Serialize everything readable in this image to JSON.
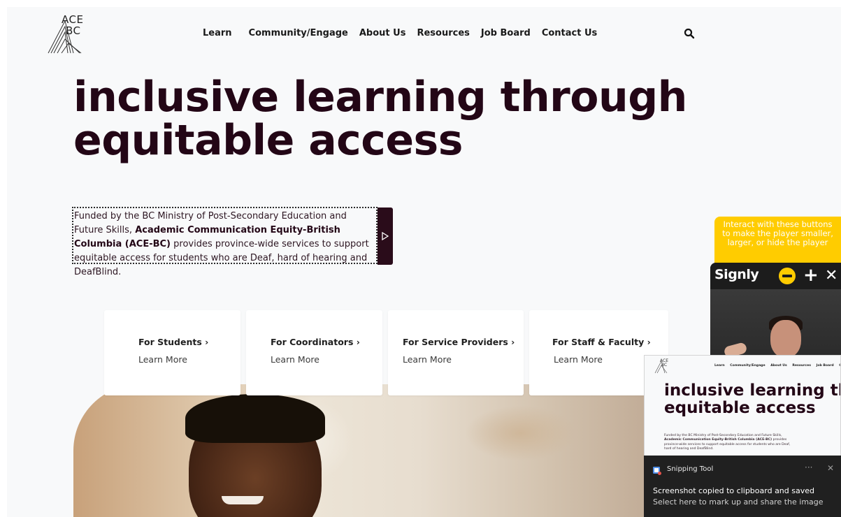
{
  "logo": {
    "line1": "ACE",
    "line2": "BC"
  },
  "nav": {
    "items": [
      "Learn",
      "Community/Engage",
      "About Us",
      "Resources",
      "Job Board",
      "Contact Us"
    ],
    "search_icon": "search-icon"
  },
  "hero": {
    "title_line1": "inclusive learning through",
    "title_line2": "equitable access",
    "intro_1": "Funded by the BC Ministry of Post-Secondary Education and Future Skills, ",
    "intro_bold": "Academic Communication Equity-British Columbia (ACE-BC)",
    "intro_2": " provides province-wide services to support equitable access for students who are Deaf, hard of hearing and DeafBlind."
  },
  "cards": [
    {
      "title": "For Students ›",
      "link": "Learn More"
    },
    {
      "title": "For Coordinators ›",
      "link": "Learn More"
    },
    {
      "title": "For Service Providers ›",
      "link": "Learn More"
    },
    {
      "title": "For Staff & Faculty ›",
      "link": "Learn More"
    }
  ],
  "tooltip": {
    "text": "Interact with these buttons to make the player smaller, larger, or hide the player"
  },
  "signly": {
    "logo": "Signly",
    "minus_icon": "minus-icon",
    "plus": "+",
    "close": "✕"
  },
  "thumbnail": {
    "logo_line1": "ACE",
    "logo_line2": "BC",
    "nav_items": [
      "Learn",
      "Community/Engage",
      "About Us",
      "Resources",
      "Job Board",
      "Co"
    ],
    "title_line1": "inclusive learning th",
    "title_line2": "equitable access",
    "intro_1": "Funded by the BC Ministry of Post-Secondary Education and Future Skills, ",
    "intro_bold": "Academic Communication Equity-British Columbia (ACE-BC)",
    "intro_2": " provides province-wide services to support equitable access for students who are Deaf, hard of hearing and DeafBlind."
  },
  "toast": {
    "app_name": "Snipping Tool",
    "more": "···",
    "close": "✕",
    "message": "Screenshot copied to clipboard and saved",
    "sub": "Select here to mark up and share the image"
  },
  "colors": {
    "accent": "#230616",
    "signly_yellow": "#ffcc00",
    "page_bg": "#f8f9fa"
  }
}
